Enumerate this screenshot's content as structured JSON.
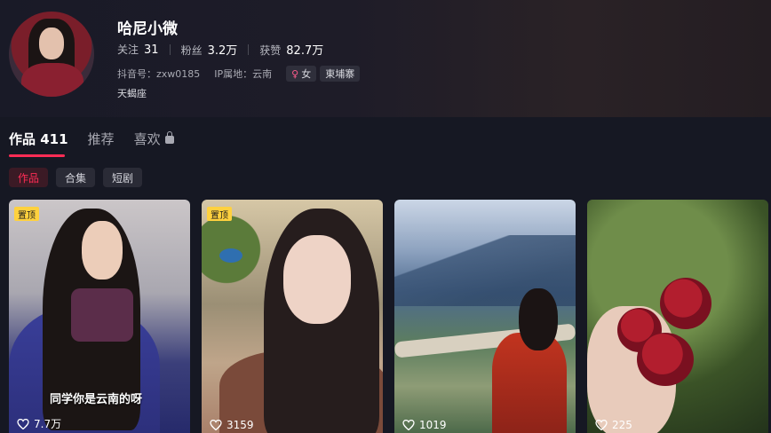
{
  "profile": {
    "name": "哈尼小微",
    "stats": [
      {
        "label": "关注",
        "value": "31"
      },
      {
        "label": "粉丝",
        "value": "3.2万"
      },
      {
        "label": "获赞",
        "value": "82.7万"
      }
    ],
    "douyin_id": "抖音号：zxw0185",
    "ip_location": "IP属地：云南",
    "gender_tag": "女",
    "location_tag": "東埔寨",
    "signature": "天蝎座"
  },
  "tabs": [
    {
      "label": "作品 411",
      "active": true
    },
    {
      "label": "推荐",
      "active": false
    },
    {
      "label": "喜欢",
      "active": false,
      "locked": true
    }
  ],
  "subtabs": [
    {
      "label": "作品",
      "active": true
    },
    {
      "label": "合集",
      "active": false
    },
    {
      "label": "短剧",
      "active": false
    }
  ],
  "videos": [
    {
      "pinned": true,
      "pin_label": "置顶",
      "caption": "同学你是云南的呀",
      "likes": "7.7万"
    },
    {
      "pinned": true,
      "pin_label": "置顶",
      "caption": "",
      "likes": "3159"
    },
    {
      "pinned": false,
      "pin_label": "",
      "caption": "",
      "likes": "1019"
    },
    {
      "pinned": false,
      "pin_label": "",
      "caption": "",
      "likes": "225"
    }
  ],
  "colors": {
    "accent": "#fe2c55",
    "background": "#161823",
    "pin": "#ffd13e"
  }
}
